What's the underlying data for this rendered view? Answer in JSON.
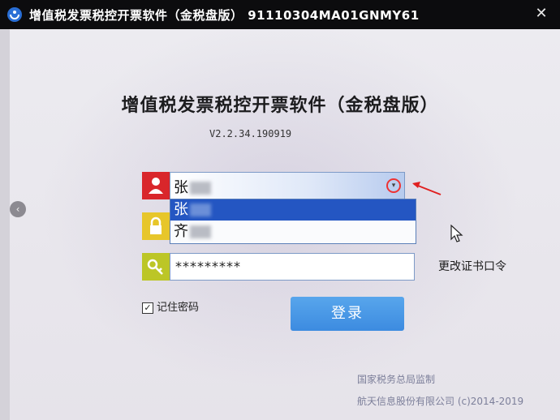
{
  "window": {
    "title": "增值税发票税控开票软件（金税盘版）  91110304MA01GNMY61",
    "close_label": "✕"
  },
  "main": {
    "title": "增值税发票税控开票软件（金税盘版）",
    "version": "V2.2.34.190919"
  },
  "login": {
    "user_value": "张",
    "dropdown_options": [
      "张",
      "齐"
    ],
    "password_value": "*********",
    "remember_label": "记住密码",
    "remember_checked": "✓",
    "login_button": "登录",
    "change_password": "更改证书口令"
  },
  "footer": {
    "line1": "国家税务总局监制",
    "line2": "航天信息股份有限公司 (c)2014-2019"
  },
  "icons": {
    "user": "user-icon",
    "lock": "lock-icon",
    "key": "key-icon",
    "dropdown": "chevron-down-icon"
  },
  "colors": {
    "user_icon_bg": "#d9262b",
    "lock_icon_bg": "#e7c62a",
    "key_icon_bg": "#bcc626",
    "selected_option": "#2456c2",
    "login_button": "#3c8be0"
  }
}
